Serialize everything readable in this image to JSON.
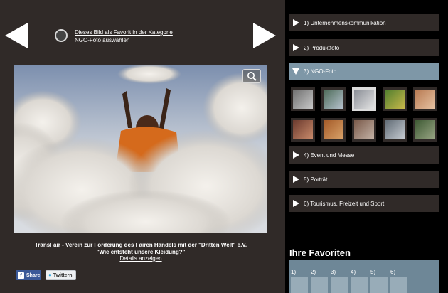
{
  "viewer": {
    "favorite_text_line1": "Dieses Bild als Favorit in der Kategorie",
    "favorite_text_line2": "NGO-Foto auswählen",
    "caption_org": "TransFair - Verein zur Förderung des Fairen Handels mit der \"Dritten Welt\" e.V.",
    "caption_title": "\"Wie entsteht unsere Kleidung?\"",
    "details_link": "Details anzeigen",
    "share_label": "Share",
    "tweet_label": "Twittern"
  },
  "categories": [
    {
      "label": "1) Unternehmenskommunikation",
      "expanded": false
    },
    {
      "label": "2) Produktfoto",
      "expanded": false
    },
    {
      "label": "3) NGO-Foto",
      "expanded": true
    },
    {
      "label": "4) Event und Messe",
      "expanded": false
    },
    {
      "label": "5) Porträt",
      "expanded": false
    },
    {
      "label": "6) Tourismus, Freizeit und Sport",
      "expanded": false
    }
  ],
  "thumbnails": [
    {
      "colors": [
        "#6f6f6f",
        "#c8c8c8"
      ],
      "selected": false
    },
    {
      "colors": [
        "#4c6a57",
        "#b7c3cf"
      ],
      "selected": false
    },
    {
      "colors": [
        "#8a8e96",
        "#e3e3e3"
      ],
      "selected": true
    },
    {
      "colors": [
        "#4f7d2e",
        "#c8b84a"
      ],
      "selected": false
    },
    {
      "colors": [
        "#b87a52",
        "#e6c3a3"
      ],
      "selected": false
    },
    {
      "colors": [
        "#6b3a2e",
        "#c98b6b"
      ],
      "selected": false
    },
    {
      "colors": [
        "#a35a28",
        "#d9a36a"
      ],
      "selected": false
    },
    {
      "colors": [
        "#7a5a4a",
        "#c4b3a7"
      ],
      "selected": false
    },
    {
      "colors": [
        "#5f6a74",
        "#c7ccd2"
      ],
      "selected": false
    },
    {
      "colors": [
        "#3e5a34",
        "#9aa685"
      ],
      "selected": false
    }
  ],
  "favorites": {
    "title": "Ihre Favoriten",
    "slots": [
      "1)",
      "2)",
      "3)",
      "4)",
      "5)",
      "6)"
    ]
  },
  "icons": {
    "prev": "arrow-left-icon",
    "next": "arrow-right-icon",
    "zoom": "magnifier-icon",
    "facebook": "facebook-icon",
    "twitter": "twitter-bird-icon"
  },
  "colors": {
    "panel_bg": "#302a28",
    "active_category": "#7e97a7",
    "favorites_box": "#6e8797",
    "facebook_blue": "#3b5998"
  }
}
